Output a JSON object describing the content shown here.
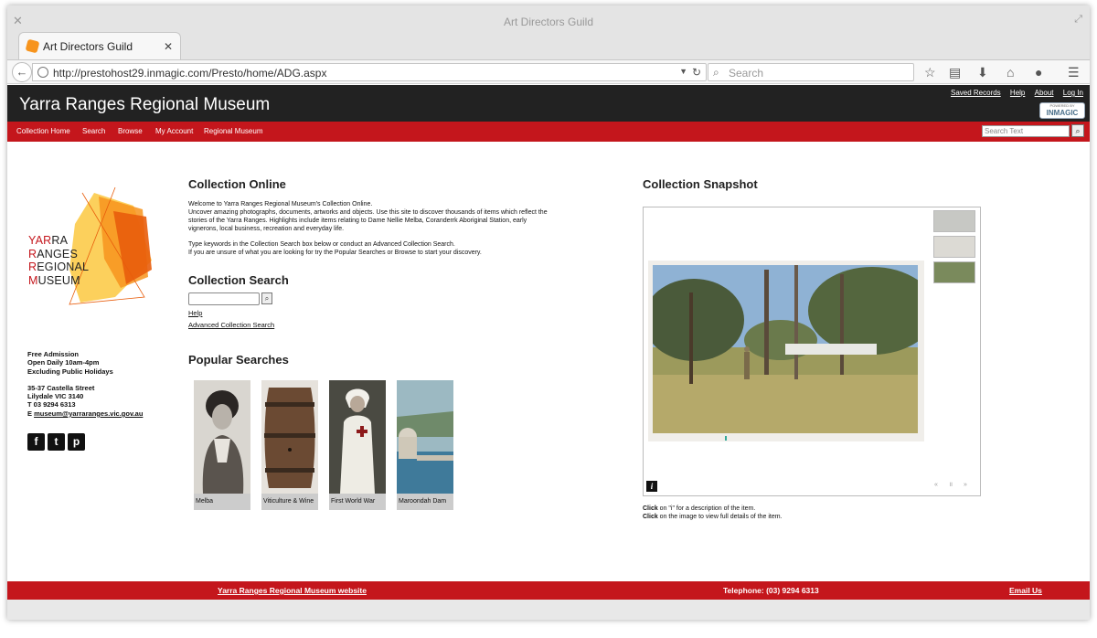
{
  "window": {
    "title": "Art Directors Guild"
  },
  "tab": {
    "title": "Art Directors Guild"
  },
  "browser": {
    "url": "http://prestohost29.inmagic.com/Presto/home/ADG.aspx",
    "search_placeholder": "Search"
  },
  "site": {
    "title": "Yarra Ranges Regional Museum",
    "header_links": [
      "Saved Records",
      "Help",
      "About",
      "Log In"
    ],
    "badge_small": "POWERED BY",
    "badge_big": "INMAGIC",
    "nav": [
      "Collection Home",
      "Search",
      "Browse",
      "My Account",
      "Regional Museum"
    ],
    "search_placeholder": "Search Text"
  },
  "logo": {
    "lines": [
      {
        "red": "YAR",
        "black": "RA"
      },
      {
        "red": "R",
        "black": "ANGES"
      },
      {
        "red": "R",
        "black": "EGIONAL"
      },
      {
        "red": "M",
        "black": "USEUM"
      }
    ],
    "colors": {
      "orange": "#f7941d",
      "dark_orange": "#e85d0c",
      "yellow": "#fbc433"
    }
  },
  "info": {
    "line1": "Free Admission",
    "line2": "Open Daily 10am-4pm",
    "line3": "Excluding Public Holidays",
    "line4": "35-37 Castella Street",
    "line5": "Lilydale VIC 3140",
    "line6": "T 03 9294 6313",
    "email_prefix": "E ",
    "email": "museum@yarraranges.vic.gov.au"
  },
  "social": [
    "f",
    "t",
    "p"
  ],
  "collection_online": {
    "heading": "Collection Online",
    "p1": "Welcome to Yarra Ranges Regional Museum's Collection Online.",
    "p2": "Uncover amazing photographs, documents, artworks and objects. Use this site to discover thousands of items which reflect the stories of the Yarra Ranges. Highlights include items relating to Dame Nellie Melba, Coranderrk Aboriginal Station, early vignerons, local business, recreation and everyday life.",
    "p3": "Type keywords in the Collection Search box below or conduct an Advanced Collection Search.",
    "p4": "If you are unsure of what you are looking for try the Popular Searches or Browse to start your discovery."
  },
  "collection_search": {
    "heading": "Collection Search",
    "help": "Help",
    "advanced": "Advanced Collection Search"
  },
  "popular": {
    "heading": "Popular Searches",
    "items": [
      "Melba",
      "Viticulture & Wine",
      "First World War",
      "Maroondah Dam"
    ]
  },
  "snapshot": {
    "heading": "Collection Snapshot",
    "note1_bold": "Click",
    "note1": " on \"i\" for a description of the item.",
    "note2_bold": "Click",
    "note2": " on the image to view full details of the item.",
    "controls": "« ॥ »"
  },
  "footer": {
    "website": "Yarra Ranges Regional Museum website",
    "phone": "Telephone: (03) 9294 6313",
    "email": "Email Us"
  },
  "colors": {
    "red": "#c4161c",
    "header_dark": "#222222"
  }
}
